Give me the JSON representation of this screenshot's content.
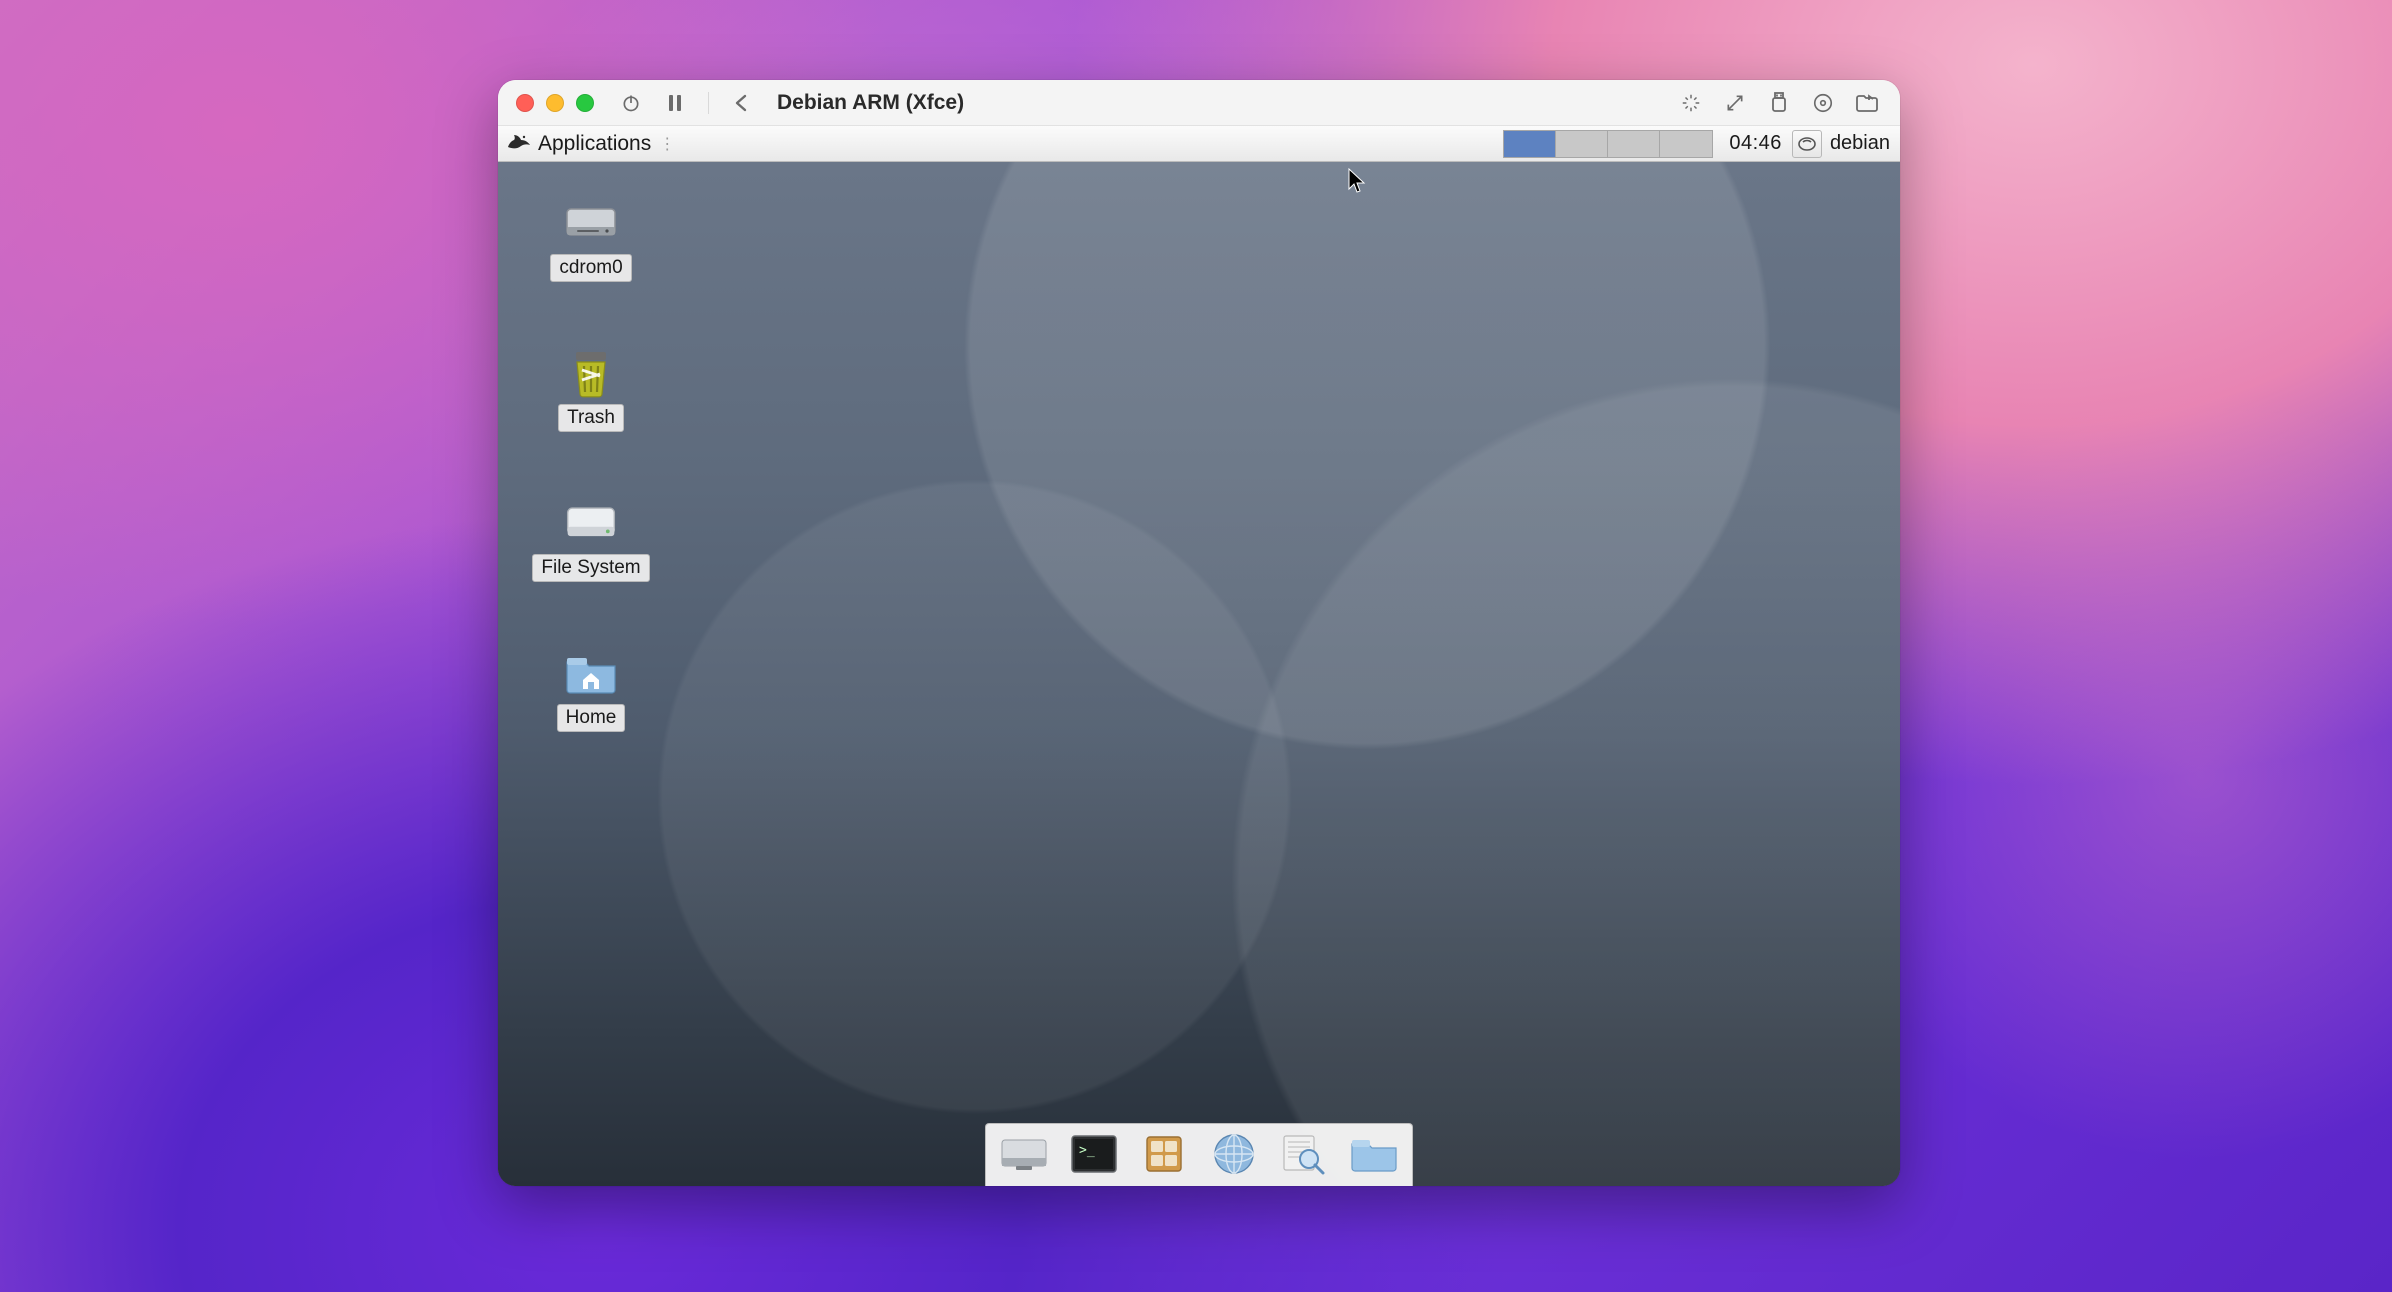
{
  "host": {
    "window_title": "Debian ARM (Xfce)",
    "toolbar_icons": {
      "power": "power-icon",
      "pause": "pause-icon",
      "back": "back-icon",
      "display": "sparkle-icon",
      "resize": "resize-icon",
      "usb": "usb-icon",
      "disc": "disc-icon",
      "share": "share-folder-icon"
    }
  },
  "guest": {
    "panel": {
      "menu_label": "Applications",
      "workspaces": {
        "count": 4,
        "active": 0
      },
      "clock": "04:46",
      "user": "debian"
    },
    "desktop_icons": [
      {
        "name": "cdrom0",
        "icon": "drive-cdrom-icon"
      },
      {
        "name": "Trash",
        "icon": "trash-icon"
      },
      {
        "name": "File System",
        "icon": "drive-harddisk-icon"
      },
      {
        "name": "Home",
        "icon": "folder-home-icon"
      }
    ],
    "dock_items": [
      {
        "name": "show-desktop",
        "icon": "show-desktop-icon"
      },
      {
        "name": "terminal",
        "icon": "terminal-icon"
      },
      {
        "name": "file-manager",
        "icon": "file-manager-icon"
      },
      {
        "name": "web-browser",
        "icon": "web-browser-icon"
      },
      {
        "name": "app-finder",
        "icon": "search-app-icon"
      },
      {
        "name": "user-home",
        "icon": "folder-icon"
      }
    ]
  }
}
